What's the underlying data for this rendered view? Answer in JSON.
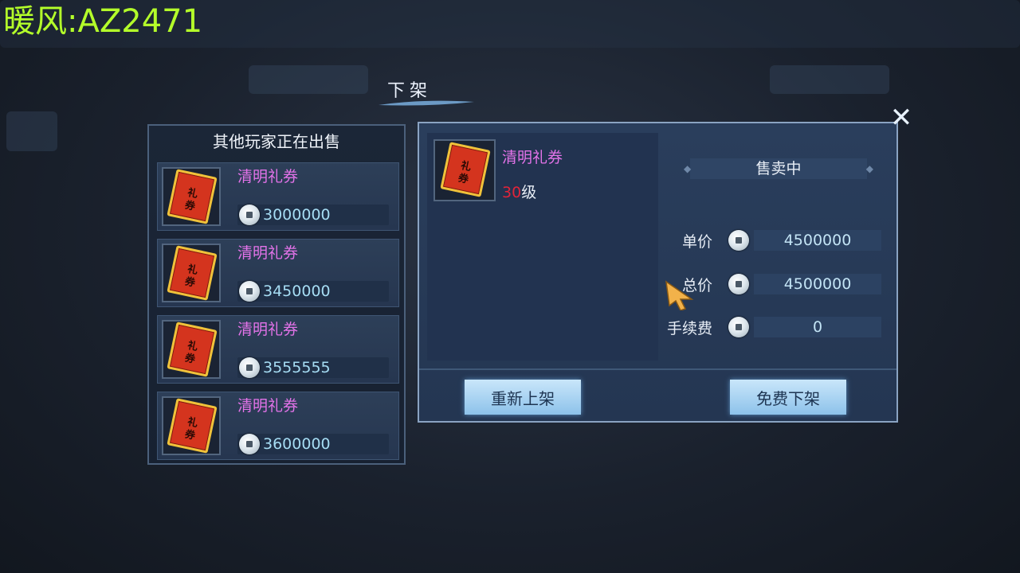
{
  "watermark": "暖风:AZ2471",
  "dialog_title": "下架",
  "left_panel": {
    "header": "其他玩家正在出售",
    "listings": [
      {
        "name": "清明礼券",
        "price": "3000000"
      },
      {
        "name": "清明礼券",
        "price": "3450000"
      },
      {
        "name": "清明礼券",
        "price": "3555555"
      },
      {
        "name": "清明礼券",
        "price": "3600000"
      }
    ]
  },
  "selected_item": {
    "name": "清明礼券",
    "level_number": "30",
    "level_suffix": "级",
    "icon_text_top": "礼",
    "icon_text_bottom": "券"
  },
  "status": "售卖中",
  "pricing": {
    "unit_label": "单价",
    "unit_value": "4500000",
    "total_label": "总价",
    "total_value": "4500000",
    "fee_label": "手续费",
    "fee_value": "0"
  },
  "buttons": {
    "relist": "重新上架",
    "delist": "免费下架"
  },
  "close_icon": "close-icon",
  "colors": {
    "item_name": "#e373e9",
    "price": "#a6ddf4",
    "level": "#e0243a",
    "watermark": "#b4ff2a"
  }
}
